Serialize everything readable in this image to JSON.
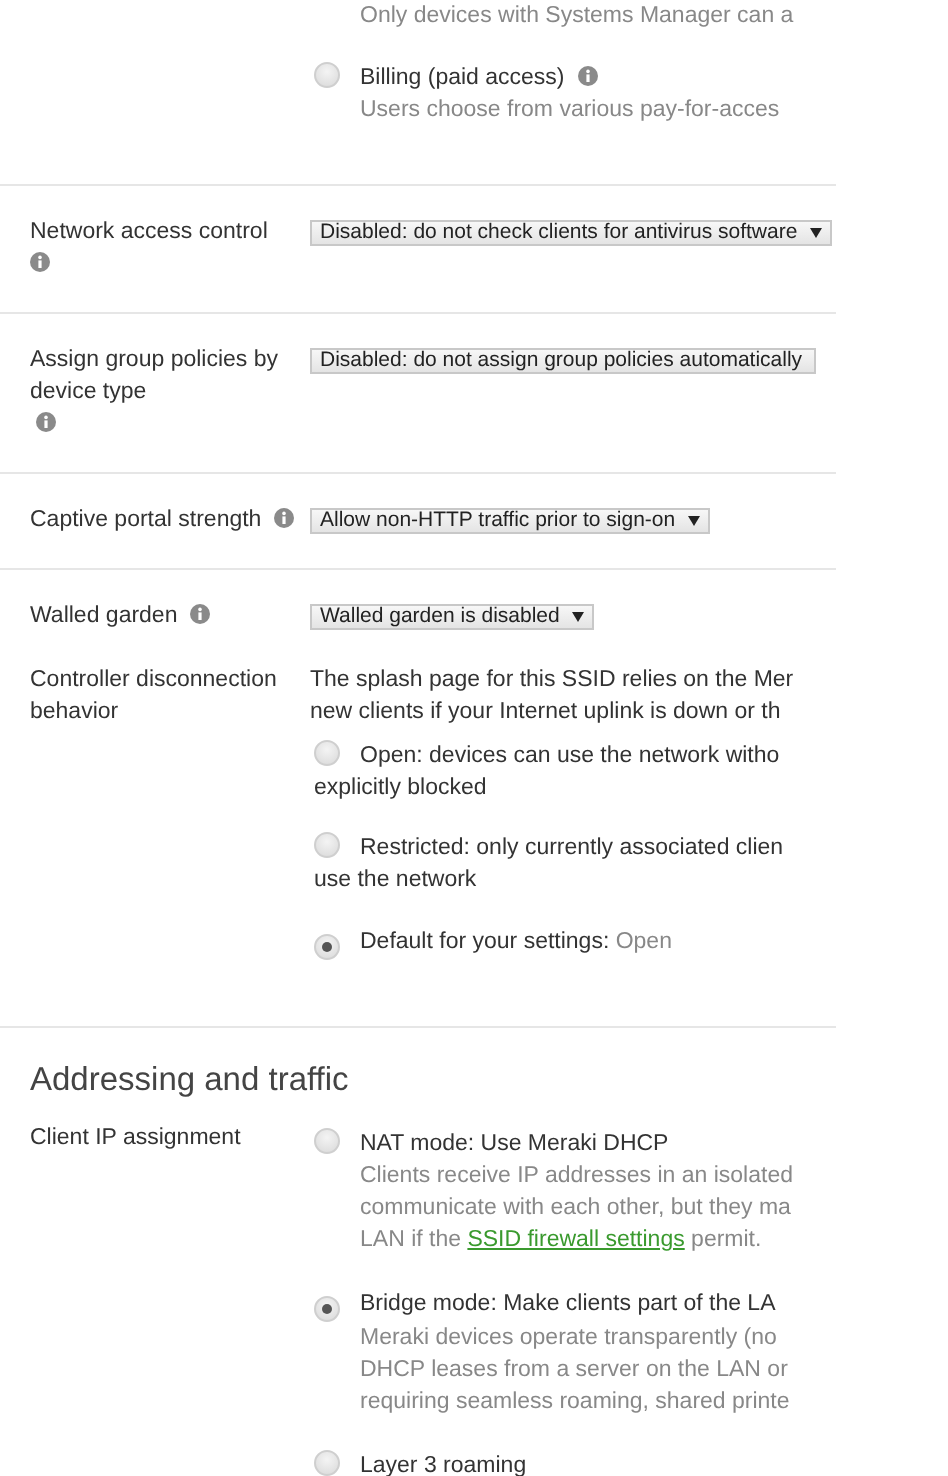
{
  "splash_page": {
    "previous_note": "Only devices with Systems Manager can a",
    "options": [
      {
        "label": "Billing (paid access)",
        "info": true,
        "selected": false,
        "description": [
          "Users choose from various pay-for-acces"
        ]
      }
    ]
  },
  "settings": [
    {
      "kind": "select",
      "label": "Network access control",
      "info": true,
      "value": "Disabled: do not check clients for antivirus software",
      "caret": true,
      "divider": true
    },
    {
      "kind": "select",
      "label": "Assign group policies by device type",
      "info": true,
      "value": "Disabled: do not assign group policies automatically",
      "caret": false,
      "divider": true
    },
    {
      "kind": "select",
      "label": "Captive portal strength",
      "info": true,
      "value": "Allow non-HTTP traffic prior to sign-on",
      "caret": true,
      "divider": true
    },
    {
      "kind": "select",
      "label": "Walled garden",
      "info": true,
      "value": "Walled garden is disabled",
      "caret": true,
      "divider": false
    },
    {
      "kind": "radios",
      "label": "Controller disconnection behavior",
      "info": false,
      "divider": false,
      "description": [
        "The splash page for this SSID relies on the Mer",
        "new clients if your Internet uplink is down or th"
      ],
      "options": [
        {
          "kind": "wrap",
          "lines": [
            "Open: devices can use the network witho",
            "explicitly blocked"
          ],
          "selected": false
        },
        {
          "kind": "wrap",
          "lines": [
            "Restricted: only currently associated clien",
            "use the network"
          ],
          "selected": false
        },
        {
          "kind": "default",
          "lines": [
            "Default for your settings:"
          ],
          "value": "Open",
          "selected": true
        }
      ]
    }
  ],
  "addressing": {
    "title": "Addressing and traffic",
    "label": "Client IP assignment",
    "options": [
      {
        "label": "NAT mode: Use Meraki DHCP",
        "selected": false,
        "description": [
          [
            {
              "text": "Clients receive IP addresses in an isolated"
            }
          ],
          [
            {
              "text": "communicate with each other, but they ma"
            }
          ],
          [
            {
              "text": "LAN if the "
            },
            {
              "text": "SSID firewall settings",
              "kind": "link"
            },
            {
              "text": " permit."
            }
          ]
        ]
      },
      {
        "label": "Bridge mode: Make clients part of the LA",
        "selected": true,
        "description": [
          [
            {
              "text": "Meraki devices operate transparently (no"
            }
          ],
          [
            {
              "text": "DHCP leases from a server on the LAN or"
            }
          ],
          [
            {
              "text": "requiring seamless roaming, shared printe"
            }
          ]
        ]
      },
      {
        "label": "Layer 3 roaming",
        "selected": false
      }
    ]
  }
}
